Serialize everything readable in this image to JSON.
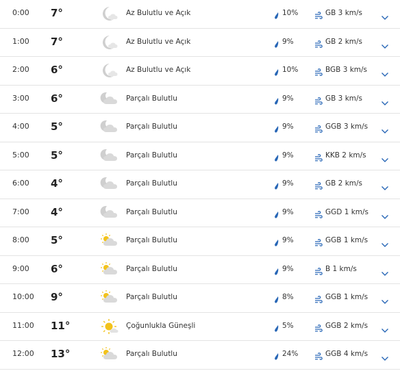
{
  "colors": {
    "accent": "#2766b6",
    "divider": "#e3e3e3",
    "cloud": "#d9d9d9",
    "moon": "#cfcfcf",
    "sun": "#f2c21b"
  },
  "hours": [
    {
      "time": "0:00",
      "temp": "7°",
      "icon": "moon-cloud-icon",
      "condition": "Az Bulutlu ve Açık",
      "precip": "10%",
      "wind": "GB 3 km/s"
    },
    {
      "time": "1:00",
      "temp": "7°",
      "icon": "moon-cloud-icon",
      "condition": "Az Bulutlu ve Açık",
      "precip": "9%",
      "wind": "GB 2 km/s"
    },
    {
      "time": "2:00",
      "temp": "6°",
      "icon": "moon-cloud-icon",
      "condition": "Az Bulutlu ve Açık",
      "precip": "10%",
      "wind": "BGB 3 km/s"
    },
    {
      "time": "3:00",
      "temp": "6°",
      "icon": "moon-partly-cloudy-icon",
      "condition": "Parçalı Bulutlu",
      "precip": "9%",
      "wind": "GB 3 km/s"
    },
    {
      "time": "4:00",
      "temp": "5°",
      "icon": "moon-partly-cloudy-icon",
      "condition": "Parçalı Bulutlu",
      "precip": "9%",
      "wind": "GGB 3 km/s"
    },
    {
      "time": "5:00",
      "temp": "5°",
      "icon": "moon-partly-cloudy-icon",
      "condition": "Parçalı Bulutlu",
      "precip": "9%",
      "wind": "KKB 2 km/s"
    },
    {
      "time": "6:00",
      "temp": "4°",
      "icon": "moon-partly-cloudy-icon",
      "condition": "Parçalı Bulutlu",
      "precip": "9%",
      "wind": "GB 2 km/s"
    },
    {
      "time": "7:00",
      "temp": "4°",
      "icon": "moon-partly-cloudy-icon",
      "condition": "Parçalı Bulutlu",
      "precip": "9%",
      "wind": "GGD 1 km/s"
    },
    {
      "time": "8:00",
      "temp": "5°",
      "icon": "sun-partly-cloudy-icon",
      "condition": "Parçalı Bulutlu",
      "precip": "9%",
      "wind": "GGB 1 km/s"
    },
    {
      "time": "9:00",
      "temp": "6°",
      "icon": "sun-partly-cloudy-icon",
      "condition": "Parçalı Bulutlu",
      "precip": "9%",
      "wind": "B 1 km/s"
    },
    {
      "time": "10:00",
      "temp": "9°",
      "icon": "sun-partly-cloudy-icon",
      "condition": "Parçalı Bulutlu",
      "precip": "8%",
      "wind": "GGB 1 km/s"
    },
    {
      "time": "11:00",
      "temp": "11°",
      "icon": "sun-mostly-sunny-icon",
      "condition": "Çoğunlukla Güneşli",
      "precip": "5%",
      "wind": "GGB 2 km/s"
    },
    {
      "time": "12:00",
      "temp": "13°",
      "icon": "sun-partly-cloudy-icon",
      "condition": "Parçalı Bulutlu",
      "precip": "24%",
      "wind": "GGB 4 km/s"
    }
  ]
}
